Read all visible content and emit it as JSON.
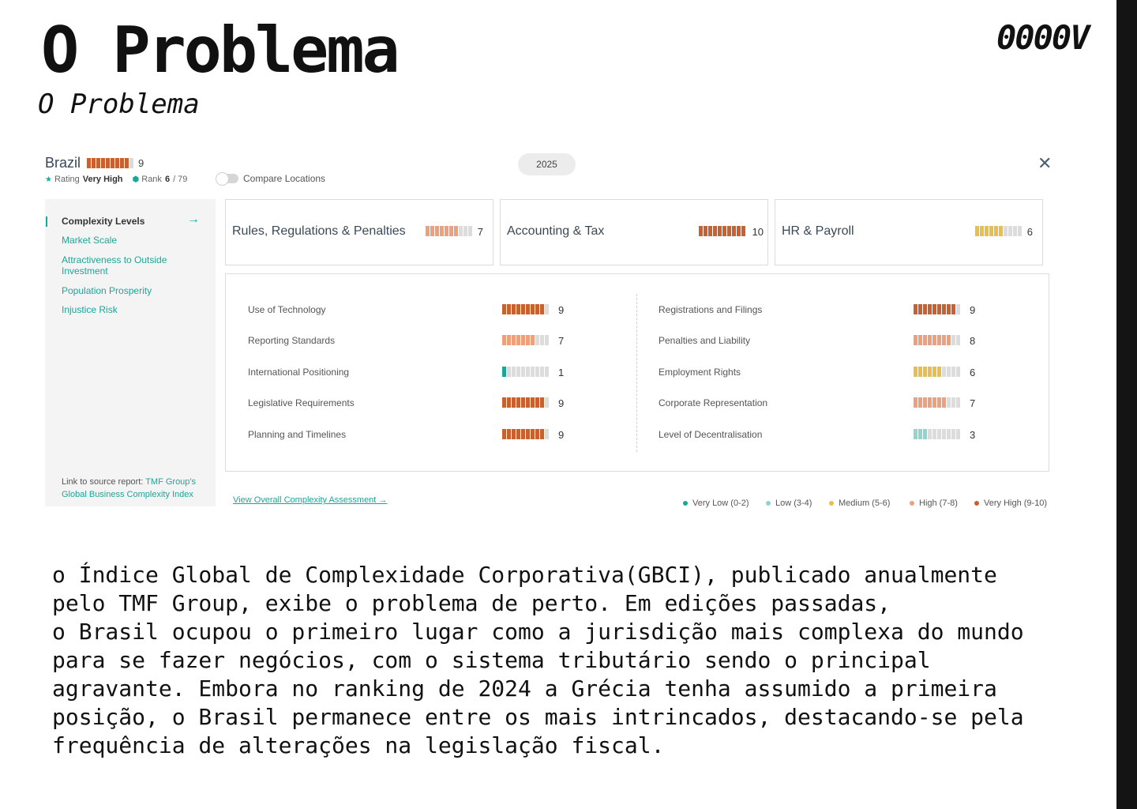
{
  "slide": {
    "title": "O Problema",
    "subtitle": "O Problema",
    "logo": "0000V"
  },
  "widget": {
    "country": "Brazil",
    "overall_score": "9",
    "rating_label": "Rating",
    "rating_value": "Very High",
    "rank_label": "Rank",
    "rank_value": "6",
    "rank_total": "/ 79",
    "compare_label": "Compare Locations",
    "year": "2025",
    "close_icon": "close-icon",
    "sidebar": {
      "items": [
        {
          "label": "Complexity Levels",
          "active": true
        },
        {
          "label": "Market Scale",
          "active": false
        },
        {
          "label": "Attractiveness to Outside Investment",
          "active": false
        },
        {
          "label": "Population Prosperity",
          "active": false
        },
        {
          "label": "Injustice Risk",
          "active": false
        }
      ],
      "source_prefix": "Link to source report: ",
      "source_link_1": "TMF Group's",
      "source_link_2": "Global Business Complexity Index"
    },
    "categories": [
      {
        "label": "Rules, Regulations & Penalties",
        "score": "7"
      },
      {
        "label": "Accounting & Tax",
        "score": "10"
      },
      {
        "label": "HR & Payroll",
        "score": "6"
      }
    ],
    "left_metrics": [
      {
        "label": "Use of Technology",
        "score": "9"
      },
      {
        "label": "Reporting Standards",
        "score": "7"
      },
      {
        "label": "International Positioning",
        "score": "1"
      },
      {
        "label": "Legislative Requirements",
        "score": "9"
      },
      {
        "label": "Planning and Timelines",
        "score": "9"
      }
    ],
    "right_metrics": [
      {
        "label": "Registrations and Filings",
        "score": "9"
      },
      {
        "label": "Penalties and Liability",
        "score": "8"
      },
      {
        "label": "Employment Rights",
        "score": "6"
      },
      {
        "label": "Corporate Representation",
        "score": "7"
      },
      {
        "label": "Level of Decentralisation",
        "score": "3"
      }
    ],
    "view_link": "View Overall Complexity Assessment →",
    "legend": [
      {
        "label": "Very Low (0-2)",
        "color": "#1aa79a"
      },
      {
        "label": "Low (3-4)",
        "color": "#8fd6cf"
      },
      {
        "label": "Medium (5-6)",
        "color": "#e9bf4c"
      },
      {
        "label": "High (7-8)",
        "color": "#ee9f7c"
      },
      {
        "label": "Very High (9-10)",
        "color": "#c8612f"
      }
    ],
    "colors": {
      "accent": "#1aa79a",
      "empty_segment": "#dcdcdc"
    }
  },
  "paragraph": [
    "o Índice Global de Complexidade Corporativa(GBCI), publicado anualmente",
    "pelo TMF Group, exibe o problema de perto. Em edições passadas,",
    "o Brasil ocupou o primeiro lugar como a jurisdição mais complexa do mundo",
    "para se fazer negócios, com o sistema tributário sendo o principal",
    "agravante. Embora no ranking de 2024 a Grécia tenha assumido a primeira",
    "posição, o Brasil permanece entre os mais intrincados, destacando-se pela",
    "frequência de alterações na legislação fiscal."
  ]
}
